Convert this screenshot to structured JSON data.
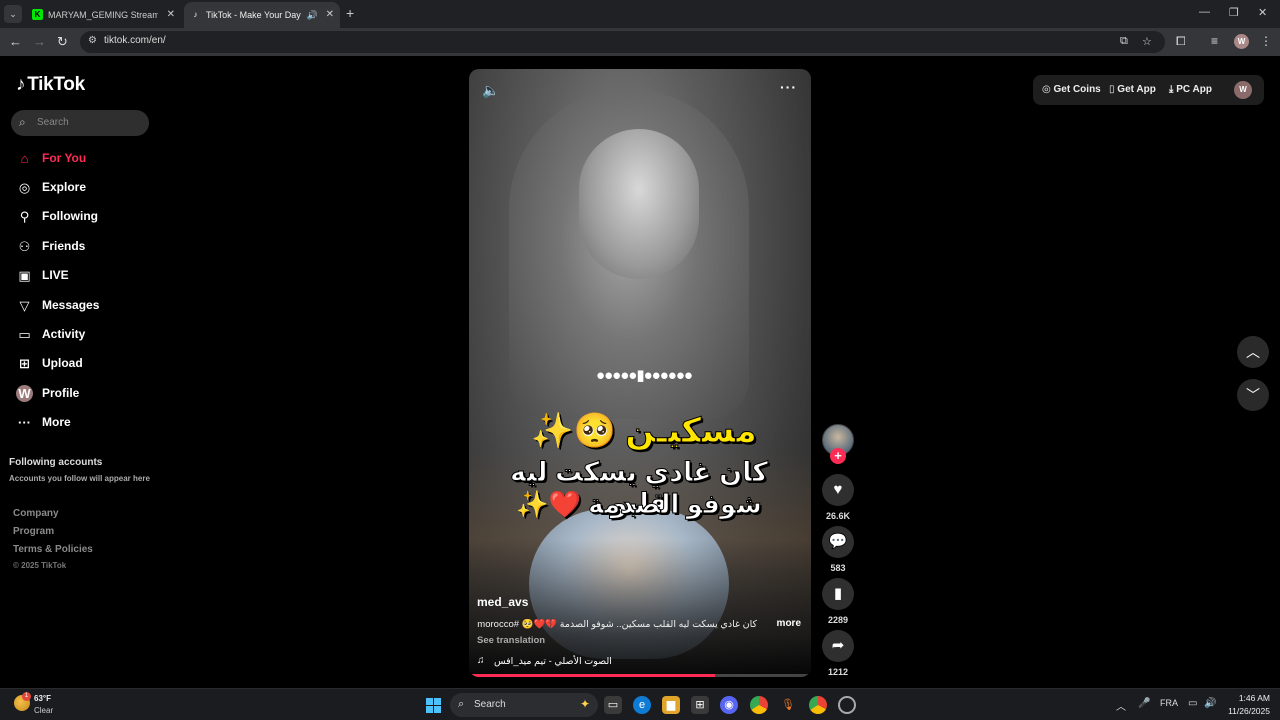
{
  "browser": {
    "tabs": [
      {
        "title": "MARYAM_GEMING Stream - Ki",
        "favicon": "K"
      },
      {
        "title": "TikTok - Make Your Day",
        "favicon": "♪",
        "active": true
      }
    ],
    "url": "tiktok.com/en/",
    "profile_initial": "W"
  },
  "tiktok": {
    "logo": "TikTok",
    "search_placeholder": "Search",
    "nav": [
      {
        "label": "For You",
        "icon": "home-icon",
        "active": true
      },
      {
        "label": "Explore",
        "icon": "compass-icon"
      },
      {
        "label": "Following",
        "icon": "person-check-icon"
      },
      {
        "label": "Friends",
        "icon": "friends-icon"
      },
      {
        "label": "LIVE",
        "icon": "live-icon"
      },
      {
        "label": "Messages",
        "icon": "send-icon"
      },
      {
        "label": "Activity",
        "icon": "activity-icon"
      },
      {
        "label": "Upload",
        "icon": "plus-box-icon"
      },
      {
        "label": "Profile",
        "icon": "avatar-icon",
        "initial": "W"
      },
      {
        "label": "More",
        "icon": "more-icon"
      }
    ],
    "following_accounts": {
      "title": "Following accounts",
      "subtitle": "Accounts you follow will appear here"
    },
    "footer": [
      "Company",
      "Program",
      "Terms & Policies"
    ],
    "copyright": "© 2025 TikTok",
    "top_right": {
      "get_coins": "Get Coins",
      "get_app": "Get App",
      "pc_app": "PC App",
      "avatar_initial": "W"
    }
  },
  "video": {
    "loading_dots": "●●●●●▮●●●●●●",
    "caption_line1": "مسكيـن 🥺✨",
    "caption_line2": "كان غادي يسكت ليه قلبو",
    "caption_line3": "شوفو الصدمة ❤️✨",
    "username": "med_avs",
    "description": "كان غادي يسكت ليه القلب مسكين.. شوفو الصدمة 💔❤️🥺 #morocco ...",
    "more_label": "more",
    "see_translation": "See translation",
    "music": "الصوت الأصلي - تيم ميد_افس",
    "progress": 0.72
  },
  "actions": {
    "likes": "26.6K",
    "comments": "583",
    "saves": "2289",
    "shares": "1212"
  },
  "taskbar": {
    "temp": "63°F",
    "weather": "Clear",
    "weather_badge": "1",
    "search": "Search",
    "lang": "FRA",
    "time": "1:46 AM",
    "date": "11/26/2025"
  },
  "colors": {
    "accent": "#fe2c55",
    "caption_yellow": "#ffe600"
  }
}
